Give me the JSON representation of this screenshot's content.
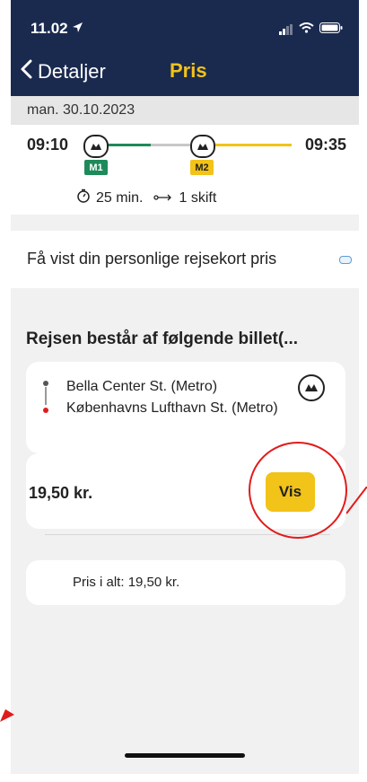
{
  "status_bar": {
    "time": "11.02"
  },
  "nav": {
    "back_label": "Detaljer",
    "title": "Pris"
  },
  "trip": {
    "date": "man. 30.10.2023",
    "departure": "09:10",
    "arrival": "09:35",
    "legs": [
      {
        "badge": "M1",
        "color": "#1e8a5a"
      },
      {
        "badge": "M2",
        "color": "#f2c318"
      }
    ],
    "duration": "25 min.",
    "changes": "1 skift"
  },
  "promo": {
    "text": "Få vist din personlige rejsekort pris"
  },
  "ticket_section": {
    "title": "Rejsen består af følgende billet(...",
    "from_stop": "Bella Center St. (Metro)",
    "to_stop": "Københavns Lufthavn St. (Metro)",
    "price": "19,50 kr.",
    "vis_label": "Vis"
  },
  "total": {
    "label": "Pris i alt:",
    "value": "19,50 kr."
  },
  "colors": {
    "header": "#1a2a4f",
    "accent": "#f2c318",
    "annotation": "#e21b1b"
  }
}
